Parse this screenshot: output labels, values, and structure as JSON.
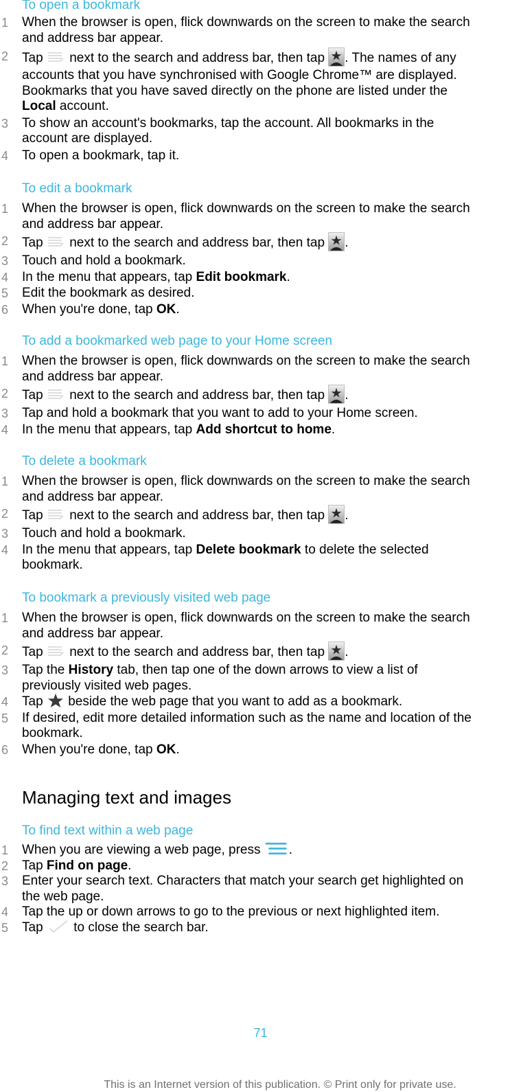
{
  "sections": [
    {
      "title": "To open a bookmark",
      "steps": [
        {
          "num": "1",
          "lines": [
            "When the browser is open, flick downwards on the screen to make the search",
            "and address bar appear."
          ]
        },
        {
          "num": "2",
          "parts": {
            "a": "Tap",
            "b": "next to the search and address bar, then tap",
            "c": ". The names of any",
            "d": "accounts that you have synchronised with Google Chrome™ are displayed.",
            "e": "Bookmarks that you have saved directly on the phone are listed under the",
            "f_bold": "Local",
            "f": " account."
          }
        },
        {
          "num": "3",
          "lines": [
            "To show an account's bookmarks, tap the account. All bookmarks in the",
            "account are displayed."
          ]
        },
        {
          "num": "4",
          "lines": [
            "To open a bookmark, tap it."
          ]
        }
      ]
    },
    {
      "title": "To edit a bookmark",
      "steps": [
        {
          "num": "1",
          "lines": [
            "When the browser is open, flick downwards on the screen to make the search",
            "and address bar appear."
          ]
        },
        {
          "num": "2",
          "parts": {
            "a": "Tap",
            "b": "next to the search and address bar, then tap",
            "c": "."
          }
        },
        {
          "num": "3",
          "lines": [
            "Touch and hold a bookmark."
          ]
        },
        {
          "num": "4",
          "parts": {
            "a": "In the menu that appears, tap ",
            "bold": "Edit bookmark",
            "c": "."
          }
        },
        {
          "num": "5",
          "lines": [
            "Edit the bookmark as desired."
          ]
        },
        {
          "num": "6",
          "parts": {
            "a": "When you're done, tap ",
            "bold": "OK",
            "c": "."
          }
        }
      ]
    },
    {
      "title": "To add a bookmarked web page to your Home screen",
      "steps": [
        {
          "num": "1",
          "lines": [
            "When the browser is open, flick downwards on the screen to make the search",
            "and address bar appear."
          ]
        },
        {
          "num": "2",
          "parts": {
            "a": "Tap",
            "b": "next to the search and address bar, then tap",
            "c": "."
          }
        },
        {
          "num": "3",
          "lines": [
            "Tap and hold a bookmark that you want to add to your Home screen."
          ]
        },
        {
          "num": "4",
          "parts": {
            "a": "In the menu that appears, tap ",
            "bold": "Add shortcut to home",
            "c": "."
          }
        }
      ]
    },
    {
      "title": "To delete a bookmark",
      "steps": [
        {
          "num": "1",
          "lines": [
            "When the browser is open, flick downwards on the screen to make the search",
            "and address bar appear."
          ]
        },
        {
          "num": "2",
          "parts": {
            "a": "Tap",
            "b": "next to the search and address bar, then tap",
            "c": "."
          }
        },
        {
          "num": "3",
          "lines": [
            "Touch and hold a bookmark."
          ]
        },
        {
          "num": "4",
          "parts": {
            "a": "In the menu that appears, tap ",
            "bold": "Delete bookmark",
            "c": " to delete the selected",
            "d": "bookmark."
          }
        }
      ]
    },
    {
      "title": "To bookmark a previously visited web page",
      "steps": [
        {
          "num": "1",
          "lines": [
            "When the browser is open, flick downwards on the screen to make the search",
            "and address bar appear."
          ]
        },
        {
          "num": "2",
          "parts": {
            "a": "Tap",
            "b": "next to the search and address bar, then tap",
            "c": "."
          }
        },
        {
          "num": "3",
          "parts": {
            "a": "Tap the ",
            "bold": "History",
            "c": " tab, then tap one of the down arrows to view a list of",
            "d": "previously visited web pages."
          }
        },
        {
          "num": "4",
          "parts": {
            "a": "Tap",
            "b": "beside the web page that you want to add as a bookmark."
          }
        },
        {
          "num": "5",
          "lines": [
            "If desired, edit more detailed information such as the name and location of the",
            "bookmark."
          ]
        },
        {
          "num": "6",
          "parts": {
            "a": "When you're done, tap ",
            "bold": "OK",
            "c": "."
          }
        }
      ]
    }
  ],
  "chapter": {
    "title": "Managing text and images",
    "section": {
      "title": "To find text within a web page",
      "steps": [
        {
          "num": "1",
          "parts": {
            "a": "When you are viewing a web page, press",
            "c": "."
          }
        },
        {
          "num": "2",
          "parts": {
            "a": "Tap ",
            "bold": "Find on page",
            "c": "."
          }
        },
        {
          "num": "3",
          "lines": [
            "Enter your search text. Characters that match your search get highlighted on",
            "the web page."
          ]
        },
        {
          "num": "4",
          "lines": [
            "Tap the up or down arrows to go to the previous or next highlighted item."
          ]
        },
        {
          "num": "5",
          "parts": {
            "a": "Tap",
            "b": "to close the search bar."
          }
        }
      ]
    }
  },
  "icons": {
    "menu_list": "menu-list-icon",
    "bookmarks": "bookmarks-star-icon",
    "star": "star-icon",
    "menu_key": "menu-key-icon",
    "check": "checkmark-icon"
  },
  "colors": {
    "accent": "#3db7dc",
    "step_number": "#8a8a8a",
    "footer": "#6f6f6f"
  },
  "footer": {
    "page_number": "71",
    "note": "This is an Internet version of this publication. © Print only for private use."
  }
}
